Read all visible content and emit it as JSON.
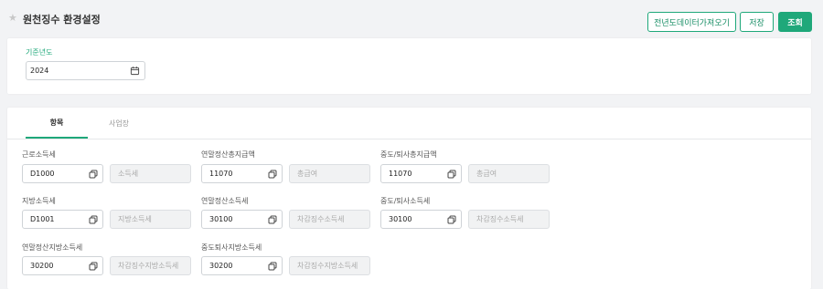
{
  "header": {
    "title": "원천징수 환경설정",
    "buttons": {
      "fetch_prev": "전년도데이터가져오기",
      "save": "저장",
      "search": "조회"
    }
  },
  "filter": {
    "year_label": "기준년도",
    "year_value": "2024"
  },
  "tabs": [
    {
      "label": "항목",
      "active": true
    },
    {
      "label": "사업장",
      "active": false
    }
  ],
  "fields": [
    {
      "label": "근로소득세",
      "code": "D1000",
      "name": "소득세"
    },
    {
      "label": "연말정산총지급액",
      "code": "11070",
      "name": "총급여"
    },
    {
      "label": "중도/퇴사총지급액",
      "code": "11070",
      "name": "총급여"
    },
    {
      "label": "지방소득세",
      "code": "D1001",
      "name": "지방소득세"
    },
    {
      "label": "연말정산소득세",
      "code": "30100",
      "name": "차감징수소득세"
    },
    {
      "label": "중도/퇴사소득세",
      "code": "30100",
      "name": "차감징수소득세"
    },
    {
      "label": "연말정산지방소득세",
      "code": "30200",
      "name": "차감징수지방소득세"
    },
    {
      "label": "중도퇴사지방소득세",
      "code": "30200",
      "name": "차감징수지방소득세"
    }
  ],
  "colors": {
    "accent": "#1fa87a",
    "background": "#f2f3f5"
  }
}
